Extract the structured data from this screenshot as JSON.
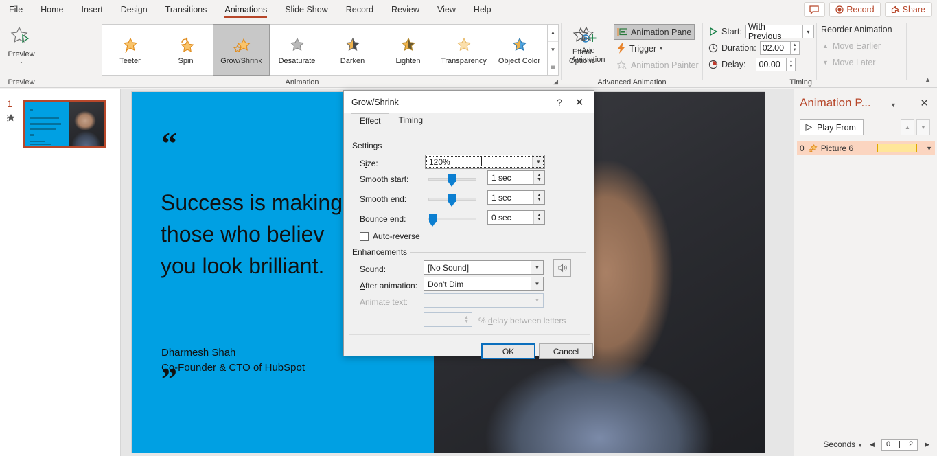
{
  "menu": {
    "items": [
      "File",
      "Home",
      "Insert",
      "Design",
      "Transitions",
      "Animations",
      "Slide Show",
      "Record",
      "Review",
      "View",
      "Help"
    ],
    "active": "Animations",
    "comment_icon": "comment-icon",
    "record_label": "Record",
    "share_label": "Share",
    "accent": "#b7472a"
  },
  "ribbon": {
    "preview": {
      "label": "Preview",
      "group": "Preview",
      "chevron": "⌄"
    },
    "animation": {
      "group": "Animation",
      "gallery": [
        {
          "label": "Teeter",
          "icon": "teeter-star-icon",
          "selected": false
        },
        {
          "label": "Spin",
          "icon": "spin-star-icon",
          "selected": false
        },
        {
          "label": "Grow/Shrink",
          "icon": "grow-shrink-star-icon",
          "selected": true
        },
        {
          "label": "Desaturate",
          "icon": "desaturate-star-icon",
          "selected": false
        },
        {
          "label": "Darken",
          "icon": "darken-star-icon",
          "selected": false
        },
        {
          "label": "Lighten",
          "icon": "lighten-star-icon",
          "selected": false
        },
        {
          "label": "Transparency",
          "icon": "transparency-star-icon",
          "selected": false
        },
        {
          "label": "Object Color",
          "icon": "object-color-star-icon",
          "selected": false
        }
      ],
      "effect_options": "Effect\nOptions"
    },
    "advanced": {
      "group": "Advanced Animation",
      "add_animation": "Add\nAnimation",
      "animation_pane": "Animation Pane",
      "trigger": "Trigger",
      "animation_painter": "Animation Painter"
    },
    "timing": {
      "group": "Timing",
      "start_label": "Start:",
      "start_value": "With Previous",
      "duration_label": "Duration:",
      "duration_value": "02.00",
      "delay_label": "Delay:",
      "delay_value": "00.00"
    },
    "reorder": {
      "title": "Reorder Animation",
      "move_earlier": "Move Earlier",
      "move_later": "Move Later"
    }
  },
  "thumbnails": {
    "slide_number": "1",
    "star_icon": "animation-star-icon"
  },
  "slide": {
    "quote_open": "“",
    "quote_body": "Success is making\nthose who believ\nyou look brilliant.",
    "quote_close": "”",
    "attribution": "Dharmesh Shah\nCo-Founder & CTO of HubSpot",
    "blue": "#00a0e3"
  },
  "dialog": {
    "title": "Grow/Shrink",
    "help_glyph": "?",
    "close_glyph": "✕",
    "tabs": [
      {
        "label": "Effect",
        "active": true
      },
      {
        "label": "Timing",
        "active": false
      }
    ],
    "settings_label": "Settings",
    "size_label": "Size:",
    "size_value": "120%",
    "smooth_start_label": "Smooth start:",
    "smooth_start_value": "1 sec",
    "smooth_end_label": "Smooth end:",
    "smooth_end_value": "1 sec",
    "bounce_end_label": "Bounce end:",
    "bounce_end_value": "0 sec",
    "auto_reverse_label": "Auto-reverse",
    "auto_reverse_checked": false,
    "enhancements_label": "Enhancements",
    "sound_label": "Sound:",
    "sound_value": "[No Sound]",
    "sound_button_icon": "speaker-icon",
    "after_animation_label": "After animation:",
    "after_animation_value": "Don't Dim",
    "animate_text_label": "Animate text:",
    "animate_text_value": "",
    "delay_pct_value": "",
    "delay_pct_label": "% delay between letters",
    "ok_label": "OK",
    "cancel_label": "Cancel"
  },
  "animation_pane": {
    "title": "Animation P...",
    "dropdown_glyph": "▼",
    "close_glyph": "✕",
    "play_from": "Play From",
    "play_icon": "play-triangle-icon",
    "move_up_icon": "move-up-icon",
    "move_down_icon": "move-down-icon",
    "items": [
      {
        "index": "0",
        "icon": "grow-shrink-star-icon",
        "name": "Picture 6",
        "bar_color": "#ffe699"
      }
    ],
    "footer": {
      "seconds_label": "Seconds",
      "timeline_start": "0",
      "timeline_end": "2",
      "left_arrow": "◀",
      "right_arrow": "▶"
    }
  }
}
